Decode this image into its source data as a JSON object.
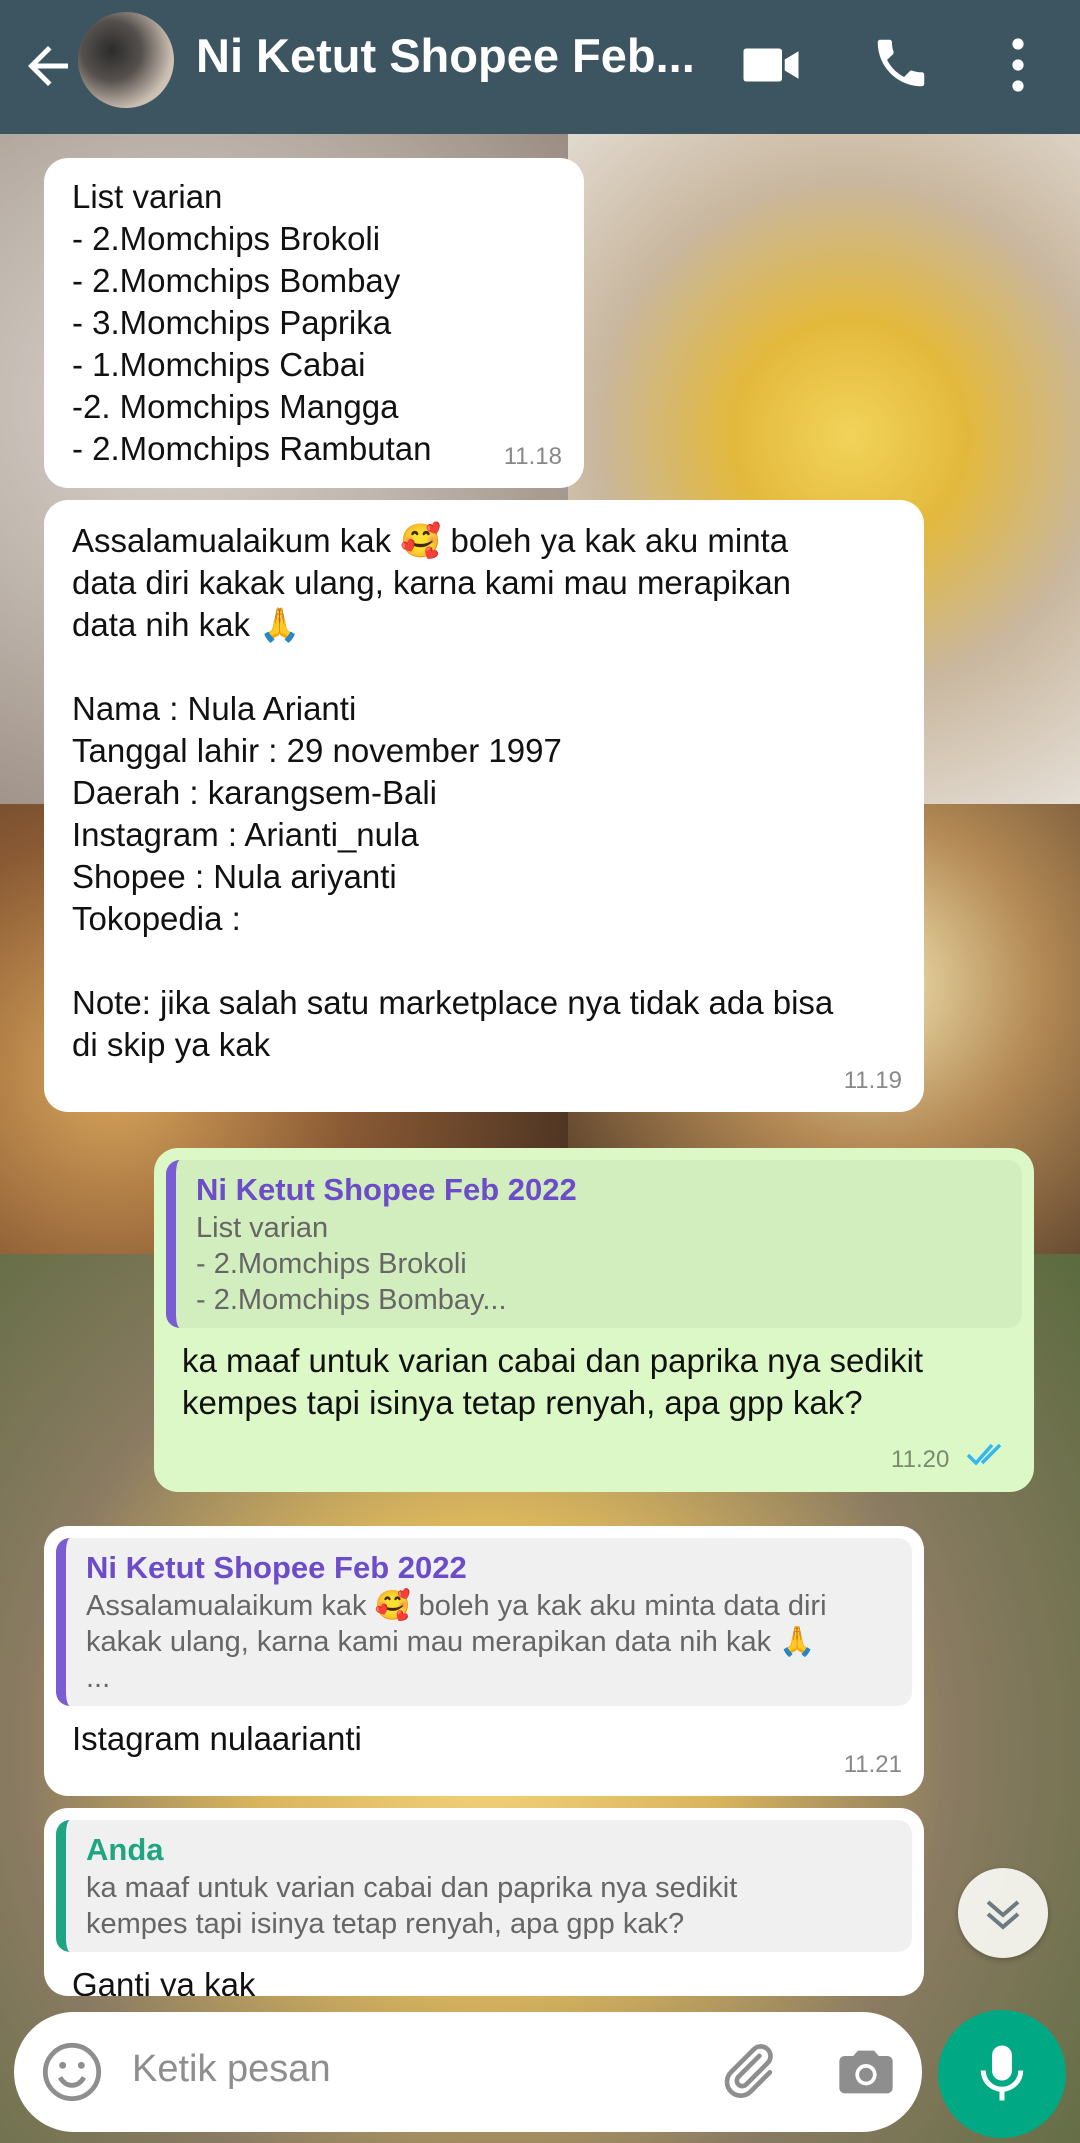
{
  "header": {
    "title": "Ni Ketut Shopee Feb...",
    "back_icon": "arrow-left-icon",
    "video_icon": "video-camera-icon",
    "call_icon": "phone-icon",
    "menu_icon": "more-vert-icon",
    "background_color": "#3d5561"
  },
  "messages": [
    {
      "direction": "in",
      "text": "List varian\n- 2.Momchips Brokoli\n- 2.Momchips Bombay\n- 3.Momchips Paprika\n- 1.Momchips Cabai\n-2. Momchips Mangga\n- 2.Momchips Rambutan",
      "time": "11.18"
    },
    {
      "direction": "in",
      "text": "Assalamualaikum kak 🥰 boleh ya kak aku minta\ndata diri kakak ulang, karna kami mau merapikan\ndata nih kak 🙏\n\nNama : Nula Arianti\nTanggal lahir : 29 november 1997\nDaerah : karangsem-Bali\nInstagram : Arianti_nula\nShopee : Nula ariyanti\nTokopedia :\n\nNote: jika salah satu marketplace nya tidak ada bisa\ndi skip ya kak",
      "time": "11.19"
    },
    {
      "direction": "out",
      "quote_name": "Ni Ketut Shopee Feb 2022",
      "quote_text": "List varian\n- 2.Momchips Brokoli\n- 2.Momchips Bombay...",
      "text": "ka maaf untuk varian cabai dan paprika nya sedikit\nkempes tapi isinya tetap renyah, apa gpp kak?",
      "time": "11.20",
      "status": "read"
    },
    {
      "direction": "in",
      "quote_name": "Ni Ketut Shopee Feb 2022",
      "quote_text": "Assalamualaikum kak 🥰 boleh ya kak aku minta data diri\nkakak ulang, karna kami mau merapikan data nih kak 🙏\n...",
      "text": "Istagram nulaarianti",
      "time": "11.21"
    },
    {
      "direction": "in",
      "quote_name": "Anda",
      "quote_text": "ka maaf untuk varian cabai dan paprika nya sedikit\nkempes tapi isinya tetap renyah, apa gpp kak?",
      "text": "Ganti ya kak"
    }
  ],
  "input": {
    "placeholder": "Ketik pesan",
    "emoji_icon": "emoji-icon",
    "attach_icon": "paperclip-icon",
    "camera_icon": "camera-icon",
    "mic_icon": "microphone-icon"
  },
  "scroll_button_icon": "chevron-double-down-icon",
  "colors": {
    "incoming_bubble": "#ffffff",
    "outgoing_bubble": "#dcf8c6",
    "quote_accent_purple": "#6c4cc9",
    "quote_accent_green": "#1fa582",
    "read_tick": "#34b7f1",
    "mic_button": "#00a884"
  }
}
